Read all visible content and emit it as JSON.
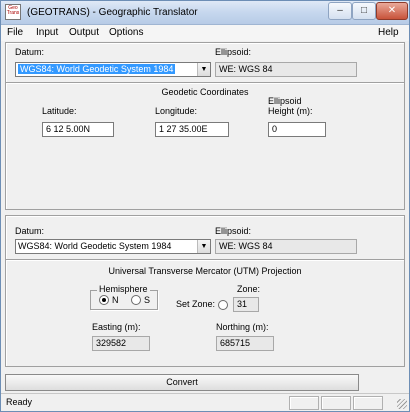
{
  "window": {
    "title": "(GEOTRANS) - Geographic Translator",
    "icon_label": "Geo Trans"
  },
  "menu": {
    "items": [
      "File",
      "Input",
      "Output",
      "Options"
    ],
    "help": "Help"
  },
  "input_panel": {
    "datum_label": "Datum:",
    "datum_value": "WGS84: World Geodetic System 1984",
    "ellipsoid_label": "Ellipsoid:",
    "ellipsoid_value": "WE: WGS 84",
    "section_title": "Geodetic Coordinates",
    "latitude_label": "Latitude:",
    "latitude_value": "6 12 5.00N",
    "longitude_label": "Longitude:",
    "longitude_value": "1 27 35.00E",
    "height_label_line1": "Ellipsoid",
    "height_label_line2": "Height (m):",
    "height_value": "0"
  },
  "output_panel": {
    "datum_label": "Datum:",
    "datum_value": "WGS84: World Geodetic System 1984",
    "ellipsoid_label": "Ellipsoid:",
    "ellipsoid_value": "WE: WGS 84",
    "section_title": "Universal Transverse Mercator (UTM) Projection",
    "hemisphere_label": "Hemisphere",
    "hemisphere_n": "N",
    "hemisphere_s": "S",
    "hemisphere_selected": "N",
    "zone_label": "Zone:",
    "set_zone_label": "Set Zone:",
    "zone_value": "31",
    "easting_label": "Easting (m):",
    "easting_value": "329582",
    "northing_label": "Northing (m):",
    "northing_value": "685715"
  },
  "convert_label": "Convert",
  "status": {
    "text": "Ready"
  }
}
